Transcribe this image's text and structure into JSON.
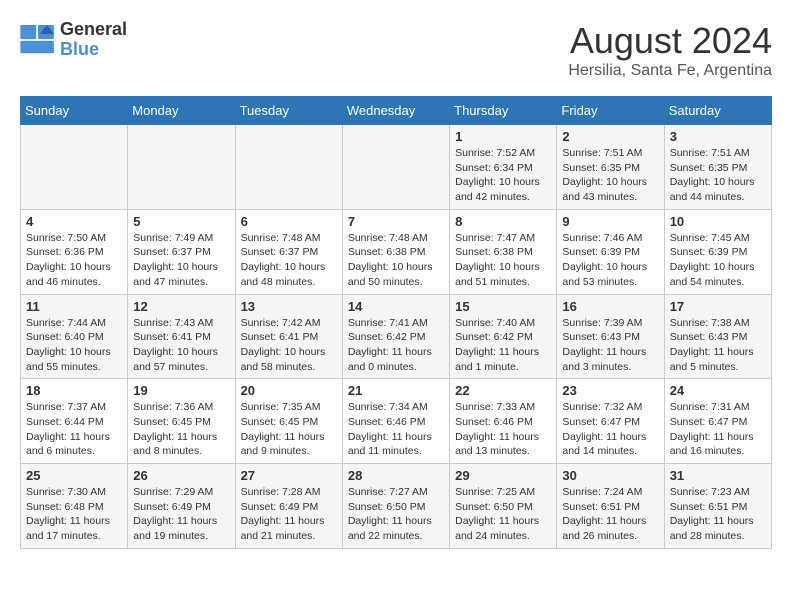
{
  "logo": {
    "text_general": "General",
    "text_blue": "Blue"
  },
  "title": "August 2024",
  "subtitle": "Hersilia, Santa Fe, Argentina",
  "weekdays": [
    "Sunday",
    "Monday",
    "Tuesday",
    "Wednesday",
    "Thursday",
    "Friday",
    "Saturday"
  ],
  "weeks": [
    [
      {
        "day": "",
        "info": ""
      },
      {
        "day": "",
        "info": ""
      },
      {
        "day": "",
        "info": ""
      },
      {
        "day": "",
        "info": ""
      },
      {
        "day": "1",
        "info": "Sunrise: 7:52 AM\nSunset: 6:34 PM\nDaylight: 10 hours\nand 42 minutes."
      },
      {
        "day": "2",
        "info": "Sunrise: 7:51 AM\nSunset: 6:35 PM\nDaylight: 10 hours\nand 43 minutes."
      },
      {
        "day": "3",
        "info": "Sunrise: 7:51 AM\nSunset: 6:35 PM\nDaylight: 10 hours\nand 44 minutes."
      }
    ],
    [
      {
        "day": "4",
        "info": "Sunrise: 7:50 AM\nSunset: 6:36 PM\nDaylight: 10 hours\nand 46 minutes."
      },
      {
        "day": "5",
        "info": "Sunrise: 7:49 AM\nSunset: 6:37 PM\nDaylight: 10 hours\nand 47 minutes."
      },
      {
        "day": "6",
        "info": "Sunrise: 7:48 AM\nSunset: 6:37 PM\nDaylight: 10 hours\nand 48 minutes."
      },
      {
        "day": "7",
        "info": "Sunrise: 7:48 AM\nSunset: 6:38 PM\nDaylight: 10 hours\nand 50 minutes."
      },
      {
        "day": "8",
        "info": "Sunrise: 7:47 AM\nSunset: 6:38 PM\nDaylight: 10 hours\nand 51 minutes."
      },
      {
        "day": "9",
        "info": "Sunrise: 7:46 AM\nSunset: 6:39 PM\nDaylight: 10 hours\nand 53 minutes."
      },
      {
        "day": "10",
        "info": "Sunrise: 7:45 AM\nSunset: 6:39 PM\nDaylight: 10 hours\nand 54 minutes."
      }
    ],
    [
      {
        "day": "11",
        "info": "Sunrise: 7:44 AM\nSunset: 6:40 PM\nDaylight: 10 hours\nand 55 minutes."
      },
      {
        "day": "12",
        "info": "Sunrise: 7:43 AM\nSunset: 6:41 PM\nDaylight: 10 hours\nand 57 minutes."
      },
      {
        "day": "13",
        "info": "Sunrise: 7:42 AM\nSunset: 6:41 PM\nDaylight: 10 hours\nand 58 minutes."
      },
      {
        "day": "14",
        "info": "Sunrise: 7:41 AM\nSunset: 6:42 PM\nDaylight: 11 hours\nand 0 minutes."
      },
      {
        "day": "15",
        "info": "Sunrise: 7:40 AM\nSunset: 6:42 PM\nDaylight: 11 hours\nand 1 minute."
      },
      {
        "day": "16",
        "info": "Sunrise: 7:39 AM\nSunset: 6:43 PM\nDaylight: 11 hours\nand 3 minutes."
      },
      {
        "day": "17",
        "info": "Sunrise: 7:38 AM\nSunset: 6:43 PM\nDaylight: 11 hours\nand 5 minutes."
      }
    ],
    [
      {
        "day": "18",
        "info": "Sunrise: 7:37 AM\nSunset: 6:44 PM\nDaylight: 11 hours\nand 6 minutes."
      },
      {
        "day": "19",
        "info": "Sunrise: 7:36 AM\nSunset: 6:45 PM\nDaylight: 11 hours\nand 8 minutes."
      },
      {
        "day": "20",
        "info": "Sunrise: 7:35 AM\nSunset: 6:45 PM\nDaylight: 11 hours\nand 9 minutes."
      },
      {
        "day": "21",
        "info": "Sunrise: 7:34 AM\nSunset: 6:46 PM\nDaylight: 11 hours\nand 11 minutes."
      },
      {
        "day": "22",
        "info": "Sunrise: 7:33 AM\nSunset: 6:46 PM\nDaylight: 11 hours\nand 13 minutes."
      },
      {
        "day": "23",
        "info": "Sunrise: 7:32 AM\nSunset: 6:47 PM\nDaylight: 11 hours\nand 14 minutes."
      },
      {
        "day": "24",
        "info": "Sunrise: 7:31 AM\nSunset: 6:47 PM\nDaylight: 11 hours\nand 16 minutes."
      }
    ],
    [
      {
        "day": "25",
        "info": "Sunrise: 7:30 AM\nSunset: 6:48 PM\nDaylight: 11 hours\nand 17 minutes."
      },
      {
        "day": "26",
        "info": "Sunrise: 7:29 AM\nSunset: 6:49 PM\nDaylight: 11 hours\nand 19 minutes."
      },
      {
        "day": "27",
        "info": "Sunrise: 7:28 AM\nSunset: 6:49 PM\nDaylight: 11 hours\nand 21 minutes."
      },
      {
        "day": "28",
        "info": "Sunrise: 7:27 AM\nSunset: 6:50 PM\nDaylight: 11 hours\nand 22 minutes."
      },
      {
        "day": "29",
        "info": "Sunrise: 7:25 AM\nSunset: 6:50 PM\nDaylight: 11 hours\nand 24 minutes."
      },
      {
        "day": "30",
        "info": "Sunrise: 7:24 AM\nSunset: 6:51 PM\nDaylight: 11 hours\nand 26 minutes."
      },
      {
        "day": "31",
        "info": "Sunrise: 7:23 AM\nSunset: 6:51 PM\nDaylight: 11 hours\nand 28 minutes."
      }
    ]
  ]
}
